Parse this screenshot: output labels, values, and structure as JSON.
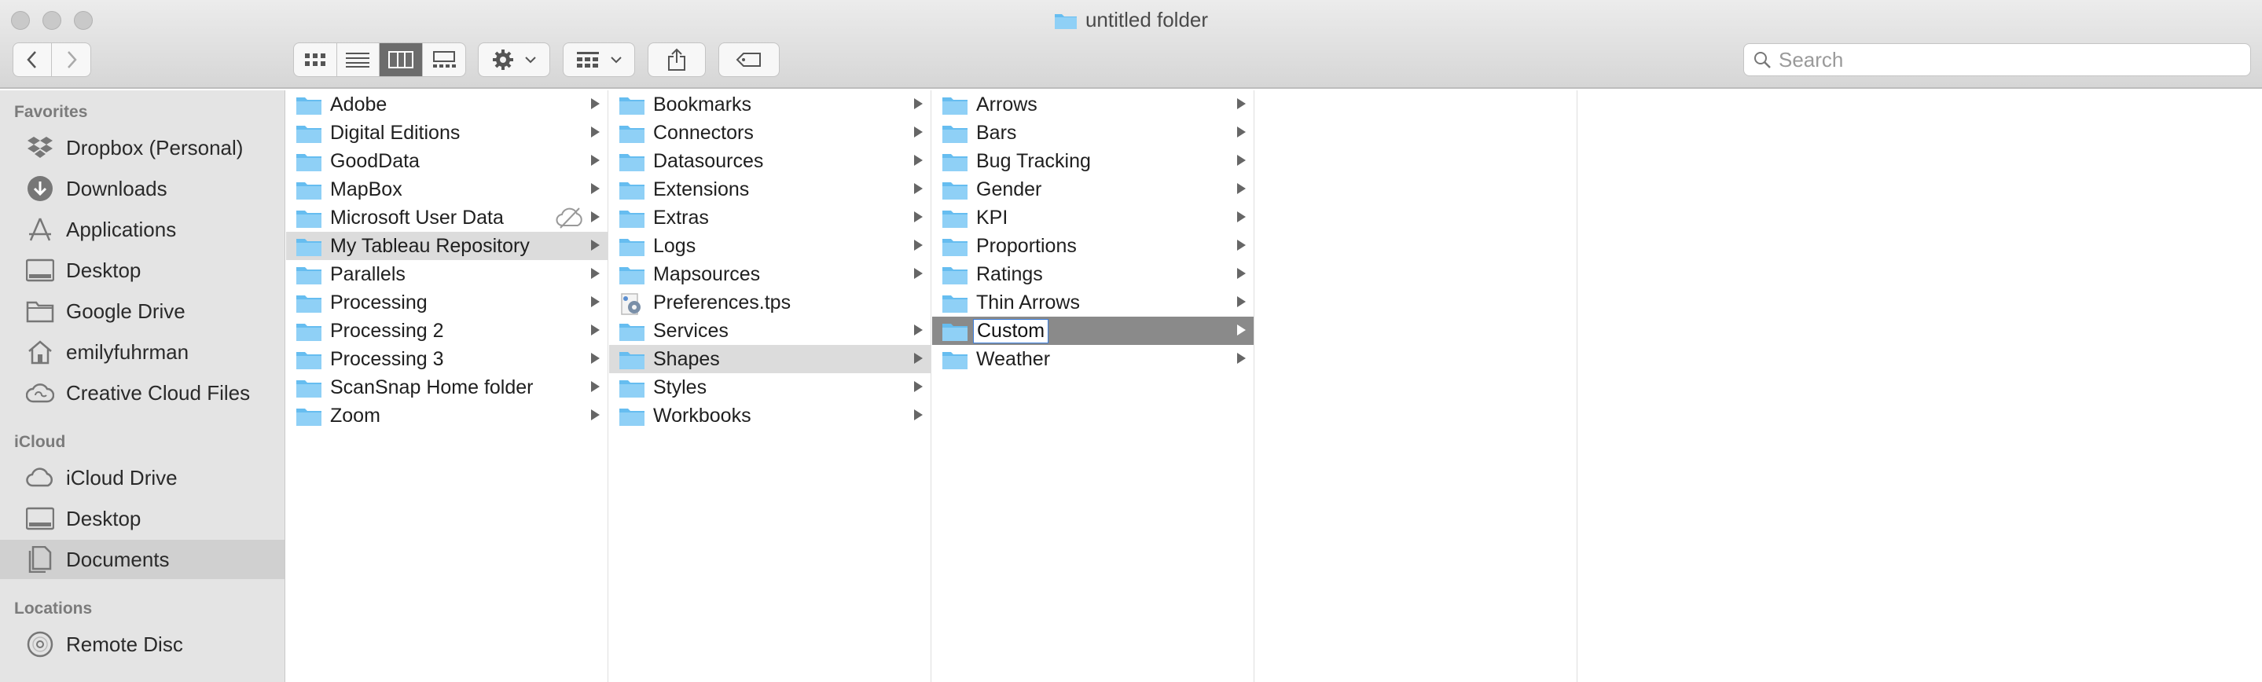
{
  "window": {
    "title": "untitled folder"
  },
  "toolbar": {
    "back_icon": "chevron-left-icon",
    "forward_icon": "chevron-right-icon",
    "view_modes": [
      "icon-view",
      "list-view",
      "column-view",
      "gallery-view"
    ],
    "active_view": "column-view",
    "action_icon": "gear-icon",
    "group_icon": "group-by-icon",
    "share_icon": "share-icon",
    "tag_icon": "tag-icon"
  },
  "search": {
    "placeholder": "Search"
  },
  "sidebar": {
    "favorites_heading": "Favorites",
    "favorites": [
      {
        "label": "Dropbox (Personal)",
        "icon": "dropbox-icon"
      },
      {
        "label": "Downloads",
        "icon": "downloads-icon"
      },
      {
        "label": "Applications",
        "icon": "applications-icon"
      },
      {
        "label": "Desktop",
        "icon": "desktop-icon"
      },
      {
        "label": "Google Drive",
        "icon": "folder-icon"
      },
      {
        "label": "emilyfuhrman",
        "icon": "home-icon"
      },
      {
        "label": "Creative Cloud Files",
        "icon": "creative-cloud-icon"
      }
    ],
    "icloud_heading": "iCloud",
    "icloud": [
      {
        "label": "iCloud Drive",
        "icon": "cloud-icon"
      },
      {
        "label": "Desktop",
        "icon": "desktop-icon"
      },
      {
        "label": "Documents",
        "icon": "documents-icon",
        "selected": true
      }
    ],
    "locations_heading": "Locations",
    "locations": [
      {
        "label": "Remote Disc",
        "icon": "disc-icon"
      }
    ]
  },
  "columns": [
    {
      "items": [
        {
          "label": "Adobe"
        },
        {
          "label": "Digital Editions"
        },
        {
          "label": "GoodData"
        },
        {
          "label": "MapBox"
        },
        {
          "label": "Microsoft User Data",
          "hidden_badge": true
        },
        {
          "label": "My Tableau Repository",
          "state": "path"
        },
        {
          "label": "Parallels"
        },
        {
          "label": "Processing"
        },
        {
          "label": "Processing 2"
        },
        {
          "label": "Processing 3"
        },
        {
          "label": "ScanSnap Home folder"
        },
        {
          "label": "Zoom"
        }
      ]
    },
    {
      "items": [
        {
          "label": "Bookmarks"
        },
        {
          "label": "Connectors"
        },
        {
          "label": "Datasources"
        },
        {
          "label": "Extensions"
        },
        {
          "label": "Extras"
        },
        {
          "label": "Logs"
        },
        {
          "label": "Mapsources"
        },
        {
          "label": "Preferences.tps",
          "type": "file"
        },
        {
          "label": "Services"
        },
        {
          "label": "Shapes",
          "state": "path"
        },
        {
          "label": "Styles"
        },
        {
          "label": "Workbooks"
        }
      ]
    },
    {
      "items": [
        {
          "label": "Arrows"
        },
        {
          "label": "Bars"
        },
        {
          "label": "Bug Tracking"
        },
        {
          "label": "Gender"
        },
        {
          "label": "KPI"
        },
        {
          "label": "Proportions"
        },
        {
          "label": "Ratings"
        },
        {
          "label": "Thin Arrows"
        },
        {
          "label": "Custom",
          "state": "current"
        },
        {
          "label": "Weather"
        }
      ]
    },
    {
      "items": []
    }
  ],
  "colors": {
    "folder_fill": "#66bdf0",
    "folder_tab": "#8fd0f6",
    "path_highlight": "#dcdcdc",
    "current_highlight": "#8a8a8a",
    "sidebar_bg": "#e4e4e4"
  }
}
